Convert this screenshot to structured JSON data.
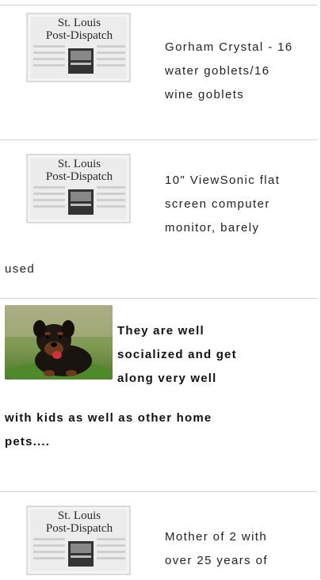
{
  "listings": [
    {
      "thumbnail": "st-louis-post-dispatch-logo",
      "logo_line1": "St. Louis",
      "logo_line2": "Post-Dispatch",
      "text_lines": [
        "Gorham Crystal - 16",
        "water goblets/16",
        "wine goblets"
      ]
    },
    {
      "thumbnail": "st-louis-post-dispatch-logo",
      "logo_line1": "St. Louis",
      "logo_line2": "Post-Dispatch",
      "text_lines": [
        "10\" ViewSonic flat",
        "screen computer",
        "monitor, barely",
        "used"
      ]
    },
    {
      "thumbnail": "puppy-photo",
      "text_lines": [
        "They are well",
        "socialized and get",
        "along very well",
        "with kids as well as other home",
        "pets...."
      ]
    },
    {
      "thumbnail": "st-louis-post-dispatch-logo",
      "logo_line1": "St. Louis",
      "logo_line2": "Post-Dispatch",
      "text_lines": [
        "Mother of 2 with",
        "over 25 years of"
      ]
    }
  ],
  "colors": {
    "divider": "#d0d0d0",
    "text": "#222222",
    "logo_text": "#2a2a2a"
  }
}
